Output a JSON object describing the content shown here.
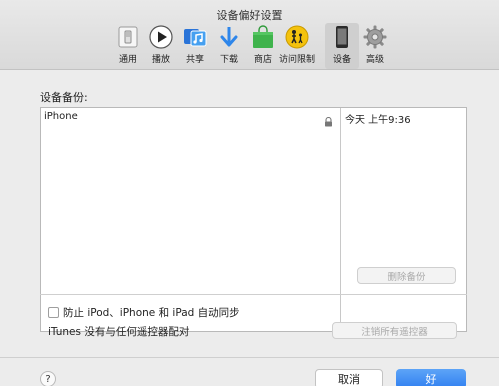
{
  "window": {
    "title": "设备偏好设置"
  },
  "toolbar": {
    "items": [
      {
        "label": "通用",
        "icon": "general-switch-icon"
      },
      {
        "label": "播放",
        "icon": "play-icon"
      },
      {
        "label": "共享",
        "icon": "sharing-music-icon"
      },
      {
        "label": "下载",
        "icon": "download-icon"
      },
      {
        "label": "商店",
        "icon": "store-bag-icon"
      },
      {
        "label": "访问限制",
        "icon": "restrictions-icon"
      },
      {
        "label": "设备",
        "icon": "device-phone-icon",
        "selected": true
      },
      {
        "label": "高级",
        "icon": "gear-icon"
      }
    ]
  },
  "backups": {
    "section_label": "设备备份:",
    "rows": [
      {
        "device": "iPhone",
        "locked": true,
        "time": "今天 上午9:36"
      }
    ],
    "delete_button": "删除备份"
  },
  "sync": {
    "checkbox_label": "防止 iPod、iPhone 和 iPad 自动同步",
    "checked": false
  },
  "remotes": {
    "label": "iTunes 没有与任何遥控器配对",
    "deauthorize_button": "注销所有遥控器"
  },
  "footer": {
    "help": "?",
    "cancel": "取消",
    "ok": "好"
  },
  "colors": {
    "accent": "#2f7ff0",
    "window_bg": "#ececec",
    "disabled_text": "#a8a8a8"
  }
}
